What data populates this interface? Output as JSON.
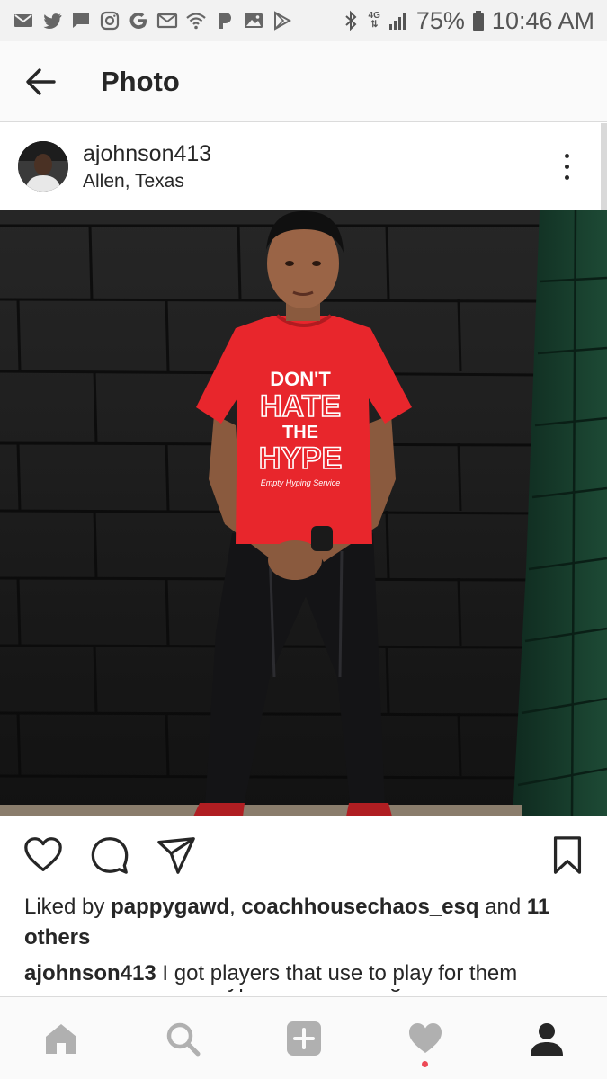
{
  "status_bar": {
    "battery": "75%",
    "time": "10:46 AM",
    "network_label": "4G",
    "left_icons": [
      "mail-icon",
      "twitter-icon",
      "chat-icon",
      "instagram-icon",
      "google-icon",
      "mail-icon",
      "wifi-icon",
      "pandora-icon",
      "gallery-icon",
      "play-store-icon"
    ]
  },
  "header": {
    "title": "Photo",
    "back_icon": "arrow-left-icon"
  },
  "post": {
    "username": "ajohnson413",
    "location": "Allen, Texas",
    "shirt_text": [
      "DON'T",
      "HATE",
      "THE",
      "HYPE"
    ],
    "shirt_script": "Empty Hyping Service"
  },
  "actions": {
    "icons": [
      "heart-icon",
      "comment-icon",
      "share-icon",
      "bookmark-icon"
    ]
  },
  "likes": {
    "prefix": "Liked by",
    "user1": "pappygawd",
    "sep": ",",
    "user2": "coachhousechaos_esq",
    "and": "and",
    "others": "11 others"
  },
  "caption": {
    "username": "ajohnson413",
    "text": "I got players that use to play for them",
    "cut_line": "that Dont Hate The Hype... Just cant figure them"
  },
  "bottom_nav": {
    "items": [
      "home-icon",
      "search-icon",
      "add-icon",
      "activity-icon",
      "profile-icon"
    ]
  },
  "colors": {
    "shirt": "#e8262c",
    "wall": "#1c1c1c",
    "green_wall": "#15382a",
    "notif": "#ed4956"
  }
}
